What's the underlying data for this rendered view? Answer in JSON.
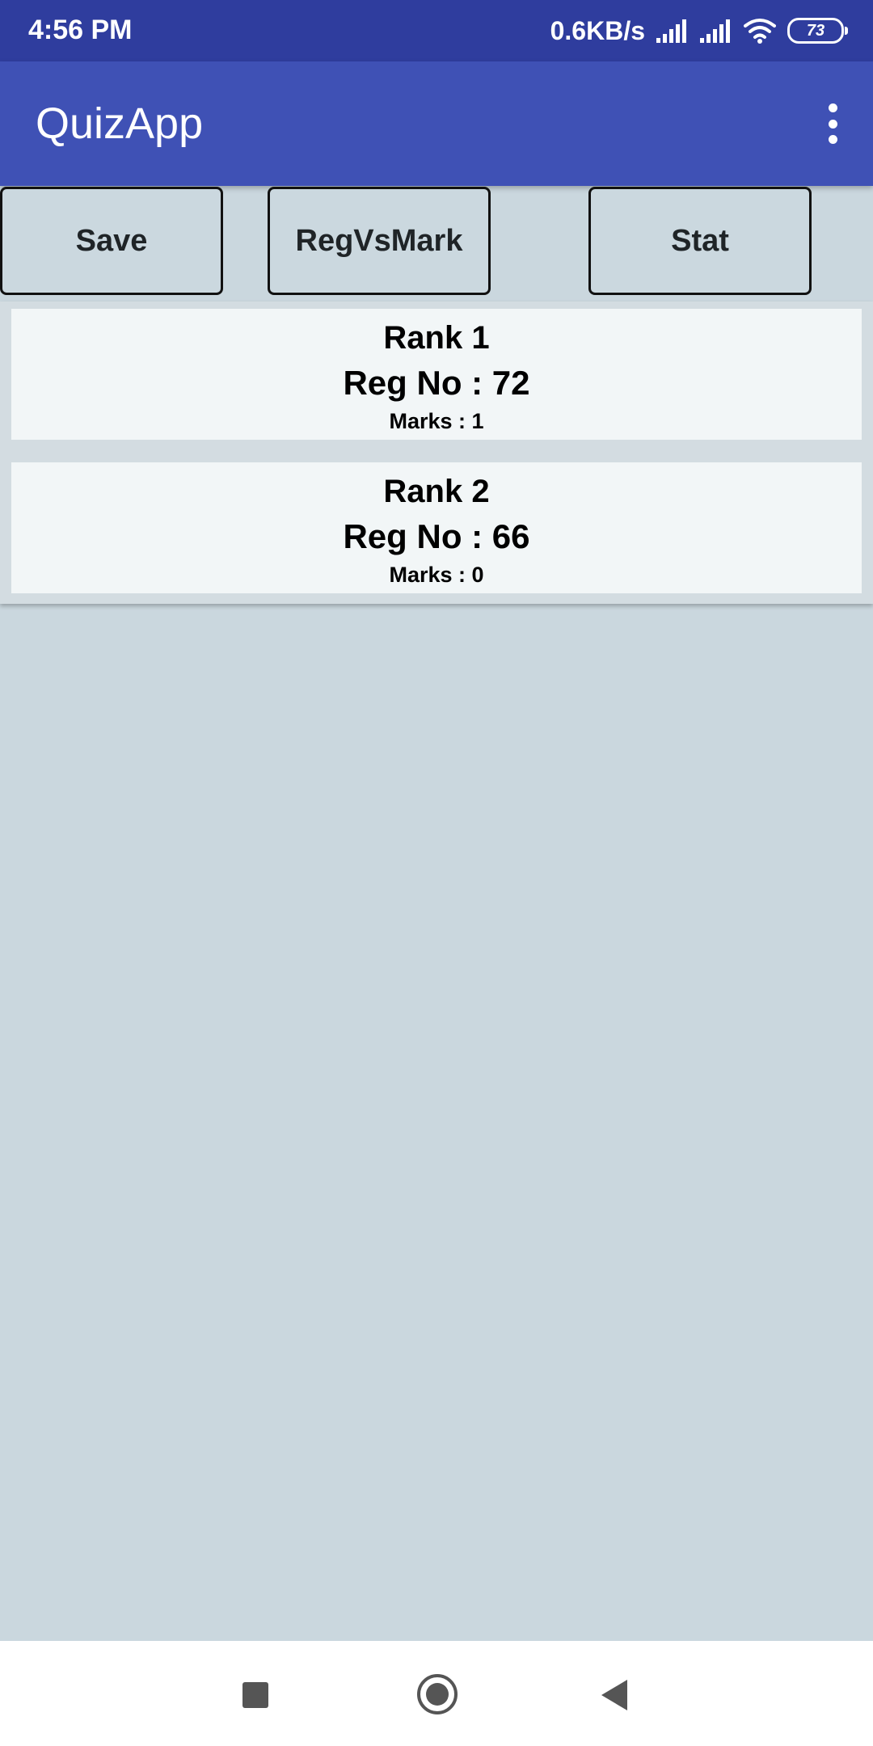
{
  "status_bar": {
    "time": "4:56 PM",
    "net_speed": "0.6KB/s",
    "battery": "73",
    "icons": [
      "signal-icon",
      "signal-icon",
      "wifi-icon",
      "battery-icon"
    ]
  },
  "app_bar": {
    "title": "QuizApp",
    "menu_icon": "overflow-menu-icon"
  },
  "buttons": {
    "save": "Save",
    "reg_vs_mark": "RegVsMark",
    "stat": "Stat"
  },
  "rankings": [
    {
      "rank": "Rank 1",
      "reg_no": "Reg No : 72",
      "marks": "Marks : 1"
    },
    {
      "rank": "Rank 2",
      "reg_no": "Reg No : 66",
      "marks": "Marks : 0"
    }
  ],
  "nav_bar": {
    "icons": [
      "recents-icon",
      "home-icon",
      "back-icon"
    ]
  },
  "colors": {
    "primary": "#3f51b5",
    "primary_dark": "#2f3d9e",
    "background": "#cad7de",
    "card": "#f2f6f7"
  }
}
